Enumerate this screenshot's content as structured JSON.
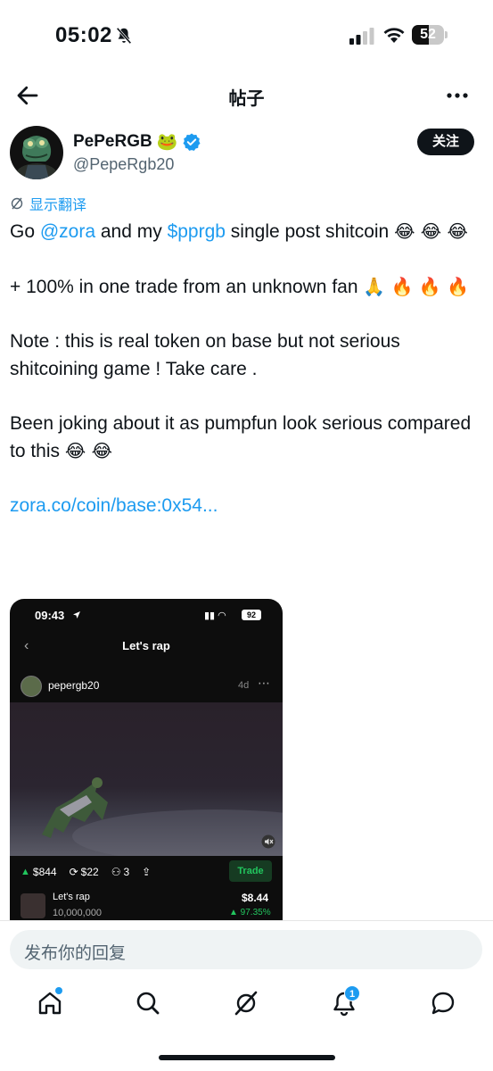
{
  "status_bar": {
    "time": "05:02",
    "battery": "52"
  },
  "nav": {
    "title": "帖子"
  },
  "author": {
    "name": "PePeRGB",
    "name_emoji": "🐸",
    "handle": "@PepeRgb20",
    "follow_label": "关注"
  },
  "translate_label": "显示翻译",
  "tweet": {
    "p1_pre": "Go ",
    "p1_mention": "@zora",
    "p1_mid": " and my ",
    "p1_cashtag": "$pprgb",
    "p1_post": " single post shitcoin ",
    "p1_emoji": "😂 😂 😂",
    "p2_text": "+ 100% in one trade from an unknown fan ",
    "p2_emoji": "🙏 🔥 🔥 🔥",
    "p3_text": "Note : this is real token on base but not serious shitcoining game ! Take care .",
    "p4_text": "Been joking about it as pumpfun look serious compared to this ",
    "p4_emoji": "😂 😂",
    "link": "zora.co/coin/base:0x54..."
  },
  "media": {
    "status_time": "09:43",
    "status_battery": "92",
    "screen_title": "Let's rap",
    "username": "pepergb20",
    "age": "4d",
    "stats": {
      "market_cap": "$844",
      "volume": "$22",
      "holders": "3"
    },
    "trade_label": "Trade",
    "coin_name": "Let's rap",
    "coin_supply": "10,000,000",
    "coin_price": "$8.44",
    "coin_change": "▲ 97.35%"
  },
  "reply": {
    "placeholder": "发布你的回复"
  },
  "tabs": {
    "notifications_count": "1"
  },
  "colors": {
    "accent": "#1d9bf0",
    "text": "#0f1419",
    "muted": "#536471",
    "trade_green": "#22c55e"
  }
}
